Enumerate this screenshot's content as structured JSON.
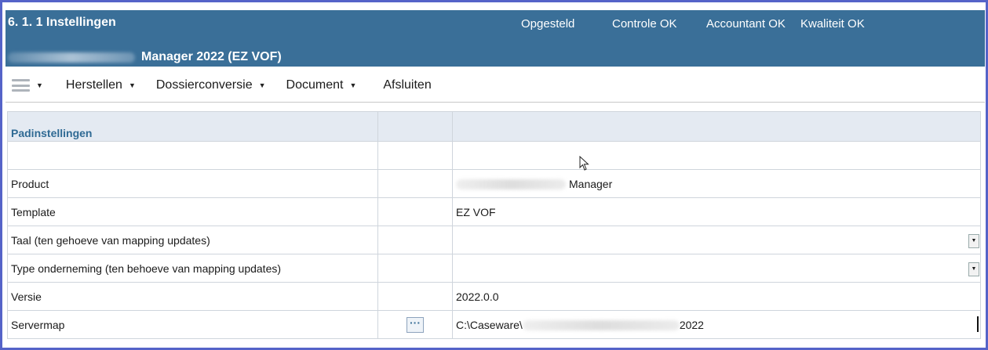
{
  "header": {
    "title": "6. 1.  1 Instellingen",
    "statuses": [
      "Opgesteld",
      "Controle OK",
      "Accountant OK",
      "Kwaliteit OK"
    ],
    "subtitle": "Manager 2022 (EZ VOF)"
  },
  "toolbar": {
    "menu_icon": "hamburger-menu-icon",
    "items": [
      {
        "label": "Herstellen",
        "has_dropdown": true
      },
      {
        "label": "Dossierconversie",
        "has_dropdown": true
      },
      {
        "label": "Document",
        "has_dropdown": true
      },
      {
        "label": "Afsluiten",
        "has_dropdown": false
      }
    ]
  },
  "grid": {
    "section_title": "Padinstellingen",
    "rows": [
      {
        "label": "",
        "value": ""
      },
      {
        "label": "Product",
        "value": "Manager"
      },
      {
        "label": "Template",
        "value": "EZ VOF"
      },
      {
        "label": "Taal (ten gehoeve van mapping updates)",
        "value": ""
      },
      {
        "label": "Type onderneming (ten behoeve van mapping updates)",
        "value": ""
      },
      {
        "label": "Versie",
        "value": "2022.0.0"
      },
      {
        "label": "Servermap",
        "value_prefix": "C:\\Caseware\\",
        "value_suffix": "2022",
        "button_label": "···"
      }
    ]
  },
  "colors": {
    "header_bg": "#3a6f98",
    "frame_border": "#5563c8",
    "section_title": "#2f6a94",
    "head_row_bg": "#e4eaf2"
  }
}
